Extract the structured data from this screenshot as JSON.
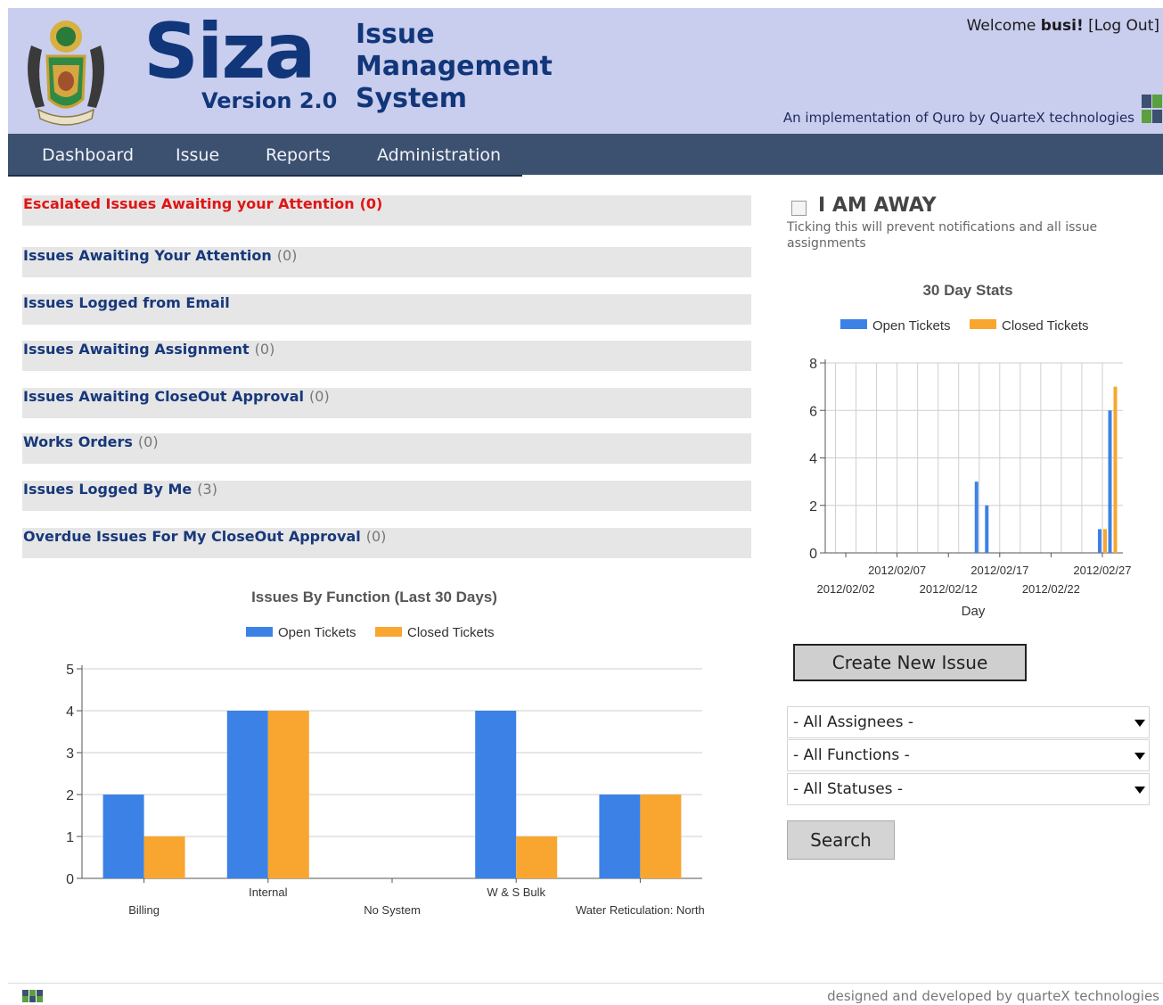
{
  "header": {
    "brand": "Siza",
    "version": "Version 2.0",
    "system_line1": "Issue",
    "system_line2": "Management",
    "system_line3": "System",
    "welcome_prefix": "Welcome",
    "username": "busi!",
    "logout": "[Log Out]",
    "tagline": "An implementation of Quro by QuarteX technologies"
  },
  "nav": {
    "items": [
      "Dashboard",
      "Issue",
      "Reports",
      "Administration"
    ]
  },
  "queues": [
    {
      "label": "Escalated Issues Awaiting your Attention",
      "count": "(0)"
    },
    {
      "label": "Issues Awaiting Your Attention",
      "count": "(0)"
    },
    {
      "label": "Issues Logged from Email",
      "count": ""
    },
    {
      "label": "Issues Awaiting Assignment",
      "count": "(0)"
    },
    {
      "label": "Issues Awaiting CloseOut Approval",
      "count": "(0)"
    },
    {
      "label": "Works Orders",
      "count": "(0)"
    },
    {
      "label": "Issues Logged By Me",
      "count": "(3)"
    },
    {
      "label": "Overdue Issues For My CloseOut Approval",
      "count": "(0)"
    }
  ],
  "away": {
    "label": "I AM AWAY",
    "note": "Ticking this will prevent notifications and all issue assignments"
  },
  "actions": {
    "create_new_issue": "Create New Issue",
    "search": "Search"
  },
  "filters": {
    "assignees": "- All Assignees -",
    "functions": "- All Functions -",
    "statuses": "- All Statuses -"
  },
  "colors": {
    "open": "#3c82e6",
    "closed": "#f8a630",
    "header_bg": "#c9cdee",
    "nav_bg": "#3c5070"
  },
  "footer": {
    "credit": "designed and developed by quarteX technologies"
  },
  "chart_data": [
    {
      "type": "bar",
      "title": "Issues By Function (Last 30 Days)",
      "categories": [
        "Billing",
        "Internal",
        "No System",
        "W & S Bulk",
        "Water Reticulation: North"
      ],
      "series": [
        {
          "name": "Open Tickets",
          "values": [
            2,
            4,
            0,
            4,
            2
          ]
        },
        {
          "name": "Closed Tickets",
          "values": [
            1,
            4,
            0,
            1,
            2
          ]
        }
      ],
      "ylim": [
        0,
        5
      ],
      "yticks": [
        0,
        1,
        2,
        3,
        4,
        5
      ],
      "legend": "top",
      "grid": true
    },
    {
      "type": "bar",
      "title": "30 Day Stats",
      "xlabel": "Day",
      "x_ticks": [
        "2012/02/02",
        "2012/02/07",
        "2012/02/12",
        "2012/02/17",
        "2012/02/22",
        "2012/02/27"
      ],
      "x_start": "2012/01/31",
      "x_end": "2012/02/29",
      "series": [
        {
          "name": "Open Tickets",
          "points": [
            {
              "x": "2012/02/15",
              "y": 3
            },
            {
              "x": "2012/02/16",
              "y": 2
            },
            {
              "x": "2012/02/27",
              "y": 1
            },
            {
              "x": "2012/02/28",
              "y": 6
            }
          ]
        },
        {
          "name": "Closed Tickets",
          "points": [
            {
              "x": "2012/02/27",
              "y": 1
            },
            {
              "x": "2012/02/28",
              "y": 7
            }
          ]
        }
      ],
      "ylim": [
        0,
        8
      ],
      "yticks": [
        0,
        2,
        4,
        6,
        8
      ],
      "legend": "top",
      "grid": true
    }
  ]
}
